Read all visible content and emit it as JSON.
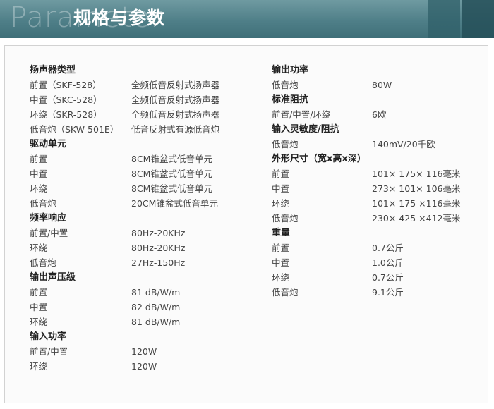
{
  "header": {
    "watermark": "Parameter",
    "title": "规格与参数",
    "colors": {
      "banner": "#4f7f88",
      "text": "#444444"
    }
  },
  "left_rows": [
    {
      "type": "header",
      "label": "扬声器类型"
    },
    {
      "type": "item",
      "label": "前置（SKF-528）",
      "value": "全频低音反射式扬声器"
    },
    {
      "type": "item",
      "label": "中置（SKC-528）",
      "value": "全频低音反射式扬声器"
    },
    {
      "type": "item",
      "label": "环绕（SKR-528）",
      "value": "全频低音反射式扬声器"
    },
    {
      "type": "item",
      "label": "低音炮（SKW-501E）",
      "value": "低音反射式有源低音炮"
    },
    {
      "type": "header",
      "label": "驱动单元"
    },
    {
      "type": "item",
      "label": "前置",
      "value": "8CM锥盆式低音单元"
    },
    {
      "type": "item",
      "label": "中置",
      "value": "8CM锥盆式低音单元"
    },
    {
      "type": "item",
      "label": "环绕",
      "value": "8CM锥盆式低音单元"
    },
    {
      "type": "item",
      "label": "低音炮",
      "value": "20CM锥盆式低音单元"
    },
    {
      "type": "header",
      "label": "频率响应"
    },
    {
      "type": "item",
      "label": "前置/中置",
      "value": "80Hz-20KHz"
    },
    {
      "type": "item",
      "label": "环绕",
      "value": "80Hz-20KHz"
    },
    {
      "type": "item",
      "label": "低音炮",
      "value": "27Hz-150Hz"
    },
    {
      "type": "header",
      "label": "输出声压级"
    },
    {
      "type": "item",
      "label": "前置",
      "value": "81 dB/W/m"
    },
    {
      "type": "item",
      "label": "中置",
      "value": "82 dB/W/m"
    },
    {
      "type": "item",
      "label": "环绕",
      "value": "81 dB/W/m"
    },
    {
      "type": "header",
      "label": "输入功率"
    },
    {
      "type": "item",
      "label": "前置/中置",
      "value": "120W"
    },
    {
      "type": "item",
      "label": "环绕",
      "value": "120W"
    }
  ],
  "right_rows": [
    {
      "type": "header",
      "label": "输出功率"
    },
    {
      "type": "item",
      "label": "低音炮",
      "value": "80W"
    },
    {
      "type": "header",
      "label": "标准阻抗"
    },
    {
      "type": "item",
      "label": "前置/中置/环绕",
      "value": "6欧"
    },
    {
      "type": "header",
      "label": "输入灵敏度/阻抗"
    },
    {
      "type": "item",
      "label": "低音炮",
      "value": "140mV/20千欧"
    },
    {
      "type": "header",
      "label": "外形尺寸（宽x高x深）"
    },
    {
      "type": "item",
      "label": "前置",
      "value": "101× 175× 116毫米"
    },
    {
      "type": "item",
      "label": "中置",
      "value": "273× 101× 106毫米"
    },
    {
      "type": "item",
      "label": "环绕",
      "value": "101× 175 ×116毫米"
    },
    {
      "type": "item",
      "label": "低音炮",
      "value": "230× 425 ×412毫米"
    },
    {
      "type": "header",
      "label": "重量"
    },
    {
      "type": "item",
      "label": "前置",
      "value": "0.7公斤"
    },
    {
      "type": "item",
      "label": "中置",
      "value": "1.0公斤"
    },
    {
      "type": "item",
      "label": "环绕",
      "value": "0.7公斤"
    },
    {
      "type": "item",
      "label": "低音炮",
      "value": "9.1公斤"
    }
  ]
}
